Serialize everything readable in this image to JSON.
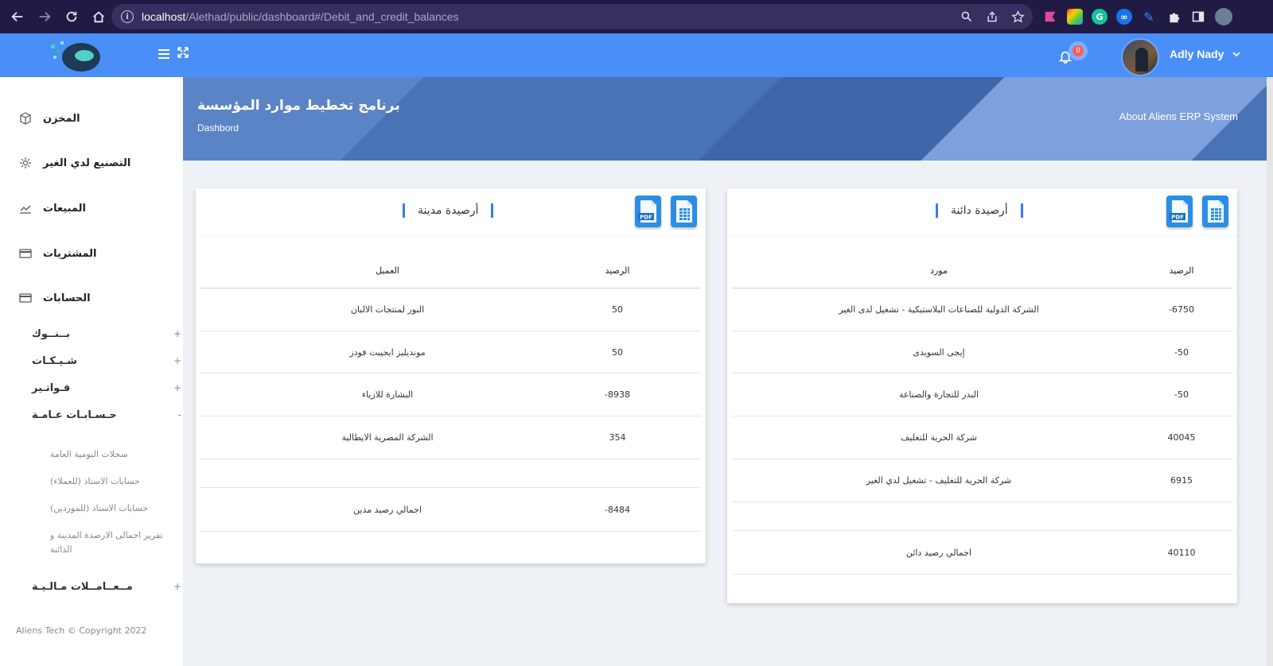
{
  "browser": {
    "url_host": "localhost",
    "url_path": "/Alethad/public/dashboard#/Debit_and_credit_balances"
  },
  "header": {
    "notification_count": "0",
    "user_name": "Adly Nady"
  },
  "banner": {
    "title": "برنامج تخطيط موارد المؤسسة",
    "subtitle": "Dashbord",
    "about_link": "About Aliens ERP System"
  },
  "sidebar": {
    "items": [
      {
        "label": "المخزن",
        "icon": "box-icon"
      },
      {
        "label": "التصنيع لدي الغير",
        "icon": "gear-icon"
      },
      {
        "label": "المبيعات",
        "icon": "chart-line-icon"
      },
      {
        "label": "المشتريات",
        "icon": "card-icon"
      },
      {
        "label": "الحسابات",
        "icon": "card-icon"
      }
    ],
    "sub_items": [
      {
        "label": "بــنــوك",
        "toggle": "+"
      },
      {
        "label": "شـيـكـات",
        "toggle": "+"
      },
      {
        "label": "فـواتـير",
        "toggle": "+"
      },
      {
        "label": "حـسـابـات عـامـة",
        "toggle": "-"
      }
    ],
    "general_accounts": [
      "سجلات اليومية العامة",
      "حسابات الاستاذ (للعملاء)",
      "حسابات الاستاذ (للموردين)",
      "تقرير اجمالى الارصدة المدينة و الدائنة"
    ],
    "financial": {
      "label": "مــعــامــلات مـالـيـة",
      "toggle": "+"
    },
    "footer": "Aliens Tech © Copyright 2022"
  },
  "debit_card": {
    "title": "أرصيدة مدينة",
    "col_balance": "الرصيد",
    "col_party": "العميل",
    "rows": [
      {
        "balance": "50",
        "party": "النور لمنتجات الالبان"
      },
      {
        "balance": "50",
        "party": "مونديليز ايجيبت فودز"
      },
      {
        "balance": "-8938",
        "party": "البشارة للازياء"
      },
      {
        "balance": "354",
        "party": "الشركة المصرية الايطالية"
      }
    ],
    "total_balance": "-8484",
    "total_label": "اجمالي رصيد مدين"
  },
  "credit_card": {
    "title": "أرصيدة دائنة",
    "col_balance": "الرصيد",
    "col_party": "مورد",
    "rows": [
      {
        "balance": "-6750",
        "party": "الشركة الدولية للصناعات البلاستيكية - تشغيل لدى الغير"
      },
      {
        "balance": "-50",
        "party": "إيجى السويدى"
      },
      {
        "balance": "-50",
        "party": "البدر للتجارة والصناعة"
      },
      {
        "balance": "40045",
        "party": "شركة الحرية للتغليف"
      },
      {
        "balance": "6915",
        "party": "شركة الحرية للتغليف - تشغيل لدي الغير"
      }
    ],
    "total_balance": "40110",
    "total_label": "اجمالي رصيد دائن"
  },
  "export": {
    "pdf_label": "PDF"
  },
  "colors": {
    "header": "#4a8ef7",
    "accent": "#3a7bf0",
    "doc_button": "#2a8fe4"
  }
}
